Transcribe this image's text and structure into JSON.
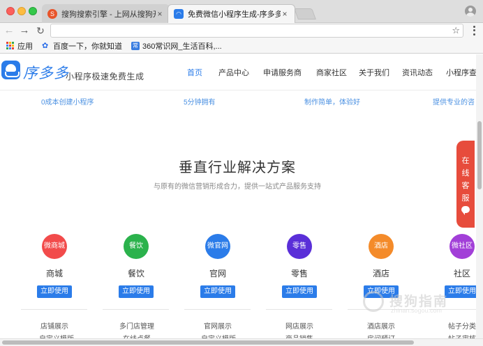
{
  "browser": {
    "tabs": [
      {
        "title": "搜狗搜索引擎 - 上网从搜狗开始",
        "close": "×",
        "favicon": "sogou-s",
        "active": false
      },
      {
        "title": "免费微信小程序生成-序多多",
        "close": "×",
        "favicon": "xuduoduo",
        "active": true
      }
    ],
    "toolbar": {
      "back": "←",
      "forward": "→",
      "reload": "↻",
      "address_value": "",
      "star": "☆"
    },
    "bookmarks": [
      {
        "label": "应用",
        "icon": "apps-grid-icon"
      },
      {
        "label": "百度一下，你就知道",
        "icon": "baidu-paw-icon"
      },
      {
        "label": "360常识网_生活百科,...",
        "icon": "360-icon"
      }
    ]
  },
  "site": {
    "logo_text": "序多多",
    "slogan": "小程序极速免费生成",
    "nav": [
      "首页",
      "产品中心",
      "申请服务商",
      "商家社区",
      "关于我们",
      "资讯动态",
      "小程序查询"
    ],
    "features": [
      "0成本创建小程序",
      "5分钟拥有",
      "制作简单，体验好",
      "提供专业的咨"
    ],
    "solutions": {
      "title": "垂直行业解决方案",
      "subtitle": "与原有的微信营销形成合力，提供一站式产品服务支持",
      "button_label": "立即使用",
      "industries": [
        {
          "name": "商城",
          "icon_text": "微商城",
          "color": "#f24b4b",
          "link_1": "店铺展示",
          "link_2": "自定义模版"
        },
        {
          "name": "餐饮",
          "icon_text": "餐饮",
          "color": "#2bb24c",
          "link_1": "多门店管理",
          "link_2": "在线点餐"
        },
        {
          "name": "官网",
          "icon_text": "微官网",
          "color": "#2b7ce9",
          "link_1": "官网展示",
          "link_2": "自定义模版"
        },
        {
          "name": "零售",
          "icon_text": "零售",
          "color": "#5a2fd8",
          "link_1": "网店展示",
          "link_2": "商品销售"
        },
        {
          "name": "酒店",
          "icon_text": "酒店",
          "color": "#f48b2a",
          "link_1": "酒店展示",
          "link_2": "房间预订"
        },
        {
          "name": "社区",
          "icon_text": "微社区",
          "color": "#a23fd8",
          "link_1": "帖子分类",
          "link_2": "帖子审核"
        }
      ]
    },
    "online_service": "在线客服"
  },
  "watermark": {
    "text": "搜狗指南",
    "url": "zhinan.sogou.com"
  }
}
